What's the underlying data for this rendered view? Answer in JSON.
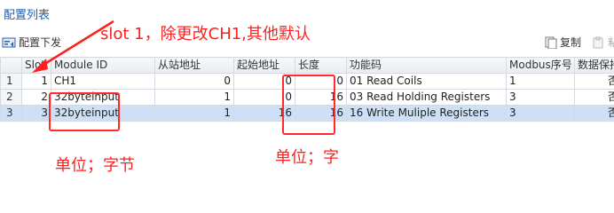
{
  "title": "配置列表",
  "toolbar": {
    "dispatch_label": "配置下发",
    "copy_label": "复制",
    "extra_label": "粘"
  },
  "table": {
    "headers": [
      "",
      "Slot",
      "Module ID",
      "从站地址",
      "起始地址",
      "长度",
      "功能码",
      "Modbus序号",
      "数据保持"
    ],
    "rows": [
      [
        "1",
        "1",
        "CH1",
        "0",
        "0",
        "0",
        "01 Read Coils",
        "1",
        "否"
      ],
      [
        "2",
        "2",
        "32byteinput",
        "1",
        "0",
        "16",
        "03 Read Holding Registers",
        "3",
        "否"
      ],
      [
        "3",
        "3",
        "32byteinput",
        "1",
        "16",
        "16",
        "16 Write Muliple Registers",
        "3",
        "否"
      ]
    ]
  },
  "annotations": {
    "top": "slot 1，除更改CH1,其他默认",
    "unit_byte": "单位；字节",
    "unit_word": "单位；字"
  },
  "colors": {
    "title": "#1a5fb4",
    "annotation": "#ff1f1f",
    "selected_row": "#cde0f7"
  }
}
